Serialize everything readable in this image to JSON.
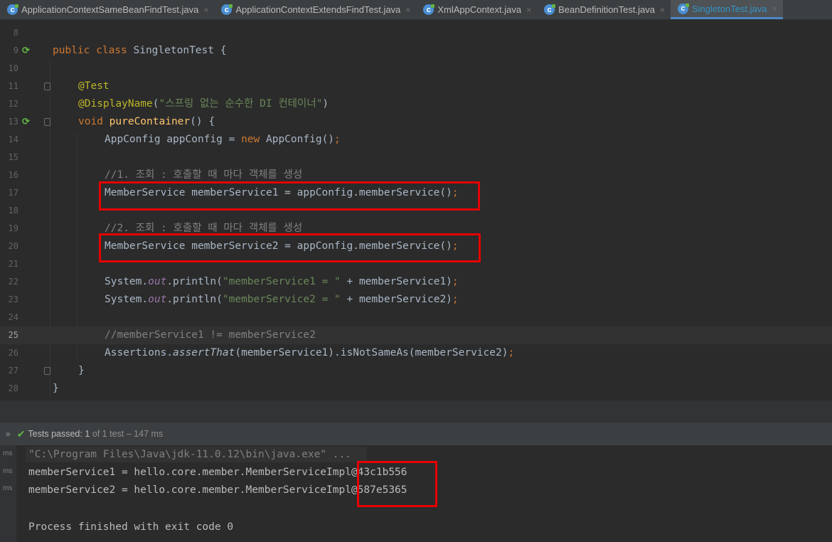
{
  "tabs": [
    {
      "label": "ApplicationContextSameBeanFindTest.java",
      "active": false
    },
    {
      "label": "ApplicationContextExtendsFindTest.java",
      "active": false
    },
    {
      "label": "XmlAppContext.java",
      "active": false
    },
    {
      "label": "BeanDefinitionTest.java",
      "active": false
    },
    {
      "label": "SingletonTest.java",
      "active": true
    }
  ],
  "tab_icon": "c",
  "close_glyph": "×",
  "editor": {
    "current_line": 25,
    "line_numbers": [
      "8",
      "9",
      "10",
      "11",
      "12",
      "13",
      "14",
      "15",
      "16",
      "17",
      "18",
      "19",
      "20",
      "21",
      "22",
      "23",
      "24",
      "25",
      "26",
      "27",
      "28"
    ],
    "code": {
      "l9": {
        "kw": "public class",
        "rest": " SingletonTest {"
      },
      "l11": {
        "an": "@Test"
      },
      "l12": {
        "an": "@DisplayName",
        "p1": "(",
        "str": "\"스프링 없는 순수한 DI 컨테이너\"",
        "p2": ")"
      },
      "l13": {
        "kw": "void",
        "fn": "pureContainer",
        "rest": "() {"
      },
      "l14": {
        "a": "AppConfig appConfig = ",
        "kw": "new",
        "b": " AppConfig()",
        "semi": ";"
      },
      "l16": {
        "cm": "//1. 조회 : 호출할 때 마다 객체를 생성"
      },
      "l17": {
        "a": "MemberService memberService1 = appConfig.memberService()",
        "semi": ";"
      },
      "l19": {
        "cm": "//2. 조회 : 호출할 때 마다 객체를 생성"
      },
      "l20": {
        "a": "MemberService memberService2 = appConfig.memberService()",
        "semi": ";"
      },
      "l22": {
        "a": "System.",
        "it": "out",
        "b": ".println(",
        "str": "\"memberService1 = \"",
        "c": " + memberService1)",
        "semi": ";"
      },
      "l23": {
        "a": "System.",
        "it": "out",
        "b": ".println(",
        "str": "\"memberService2 = \"",
        "c": " + memberService2)",
        "semi": ";"
      },
      "l25": {
        "cm": "//memberService1 != memberService2"
      },
      "l26": {
        "a": "Assertions.",
        "iti": "assertThat",
        "b": "(memberService1).isNotSameAs(memberService2)",
        "semi": ";"
      },
      "l27": {
        "a": "}"
      },
      "l28": {
        "a": "}"
      }
    }
  },
  "run_panel": {
    "status": "Tests passed:",
    "count": "1",
    "detail": "of 1 test – 147 ms",
    "ms_label": "ms",
    "output": [
      "\"C:\\Program Files\\Java\\jdk-11.0.12\\bin\\java.exe\" ...",
      "memberService1 = hello.core.member.MemberServiceImpl@43c1b556",
      "memberService2 = hello.core.member.MemberServiceImpl@587e5365",
      "",
      "Process finished with exit code 0"
    ]
  },
  "colors": {
    "keyword": "#cc7832",
    "annotation": "#bbb529",
    "string": "#6a8759",
    "comment": "#808080",
    "method": "#ffc66d",
    "highlight_box": "#e60000",
    "pass_check": "#62b543"
  },
  "icons": [
    "java-class-icon",
    "close-icon",
    "run-gutter-icon",
    "fold-icon",
    "check-icon",
    "expand-chevron-icon"
  ]
}
